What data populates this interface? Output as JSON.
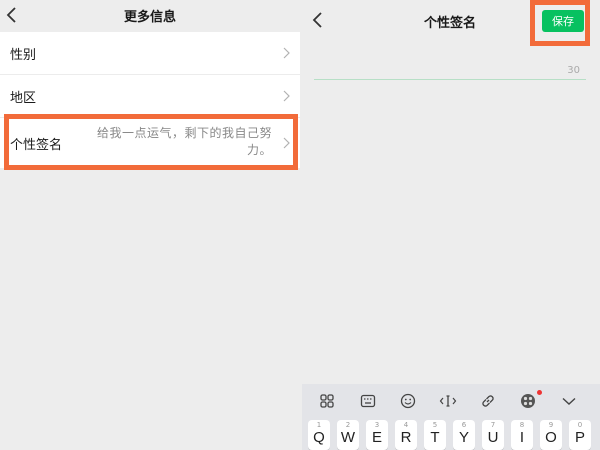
{
  "left": {
    "title": "更多信息",
    "rows": [
      {
        "label": "性别"
      },
      {
        "label": "地区"
      },
      {
        "label": "个性签名",
        "value": "给我一点运气，剩下的我自己努力。"
      }
    ]
  },
  "right": {
    "title": "个性签名",
    "save_label": "保存",
    "input_value": "",
    "counter": "30"
  },
  "keyboard": {
    "toolbar_icons": [
      "apps-grid-icon",
      "keyboard-icon",
      "emoji-icon",
      "cursor-icon",
      "link-icon",
      "theme-icon",
      "collapse-chevron-icon"
    ],
    "keys": [
      {
        "num": "1",
        "ch": "Q"
      },
      {
        "num": "2",
        "ch": "W"
      },
      {
        "num": "3",
        "ch": "E"
      },
      {
        "num": "4",
        "ch": "R"
      },
      {
        "num": "5",
        "ch": "T"
      },
      {
        "num": "6",
        "ch": "Y"
      },
      {
        "num": "7",
        "ch": "U"
      },
      {
        "num": "8",
        "ch": "I"
      },
      {
        "num": "9",
        "ch": "O"
      },
      {
        "num": "0",
        "ch": "P"
      }
    ]
  },
  "colors": {
    "highlight": "#f26b3a",
    "save_green": "#07c160",
    "background": "#ededed"
  }
}
